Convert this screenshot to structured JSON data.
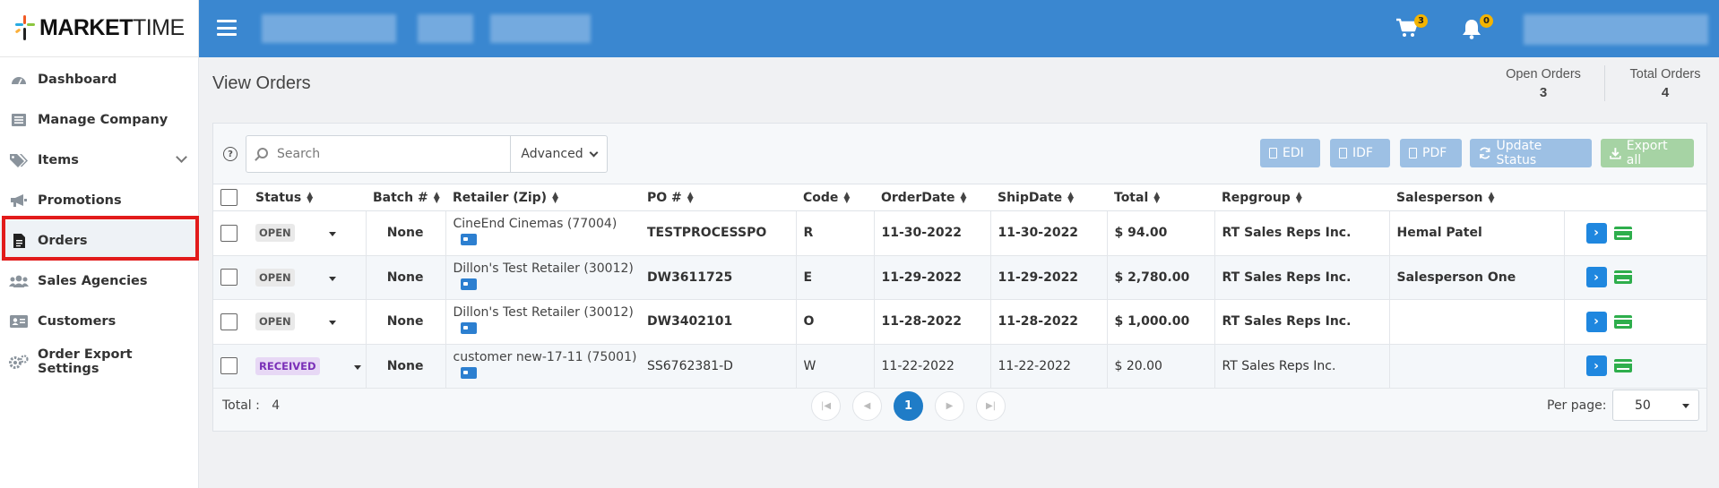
{
  "app": {
    "logo_bold": "MARKET",
    "logo_light": "TIME"
  },
  "sidebar": {
    "items": [
      {
        "label": "Dashboard",
        "icon": "dashboard-icon"
      },
      {
        "label": "Manage Company",
        "icon": "company-list-icon"
      },
      {
        "label": "Items",
        "icon": "tags-icon",
        "expandable": true
      },
      {
        "label": "Promotions",
        "icon": "megaphone-icon"
      },
      {
        "label": "Orders",
        "icon": "document-icon",
        "active": true
      },
      {
        "label": "Sales Agencies",
        "icon": "users-icon"
      },
      {
        "label": "Customers",
        "icon": "id-card-icon"
      },
      {
        "label": "Order Export Settings",
        "icon": "gears-icon"
      }
    ]
  },
  "topbar": {
    "cart_count": "3",
    "notification_count": "0"
  },
  "page": {
    "title": "View Orders",
    "open_orders_label": "Open Orders",
    "open_orders_value": "3",
    "total_orders_label": "Total Orders",
    "total_orders_value": "4"
  },
  "toolbar": {
    "help_glyph": "?",
    "search_placeholder": "Search",
    "advanced_label": "Advanced",
    "edi_label": "EDI",
    "idf_label": "IDF",
    "pdf_label": "PDF",
    "update_status_label": "Update Status",
    "export_all_label": "Export all"
  },
  "table": {
    "headers": [
      "Status",
      "Batch #",
      "Retailer (Zip)",
      "PO #",
      "Code",
      "OrderDate",
      "ShipDate",
      "Total",
      "Repgroup",
      "Salesperson"
    ],
    "rows": [
      {
        "status": "OPEN",
        "batch": "None",
        "retailer": "CineEnd Cinemas (77004)",
        "po": "TESTPROCESSPO",
        "code": "R",
        "order_date": "11-30-2022",
        "ship_date": "11-30-2022",
        "total": "$ 94.00",
        "repgroup": "RT Sales Reps Inc.",
        "salesperson": "Hemal Patel",
        "bold": true
      },
      {
        "status": "OPEN",
        "batch": "None",
        "retailer": "Dillon's Test Retailer (30012)",
        "po": "DW3611725",
        "code": "E",
        "order_date": "11-29-2022",
        "ship_date": "11-29-2022",
        "total": "$ 2,780.00",
        "repgroup": "RT Sales Reps Inc.",
        "salesperson": "Salesperson One",
        "bold": true
      },
      {
        "status": "OPEN",
        "batch": "None",
        "retailer": "Dillon's Test Retailer (30012)",
        "po": "DW3402101",
        "code": "O",
        "order_date": "11-28-2022",
        "ship_date": "11-28-2022",
        "total": "$ 1,000.00",
        "repgroup": "RT Sales Reps Inc.",
        "salesperson": "",
        "bold": true
      },
      {
        "status": "RECEIVED",
        "batch": "None",
        "retailer": "customer new-17-11 (75001)",
        "po": "SS6762381-D",
        "code": "W",
        "order_date": "11-22-2022",
        "ship_date": "11-22-2022",
        "total": "$ 20.00",
        "repgroup": "RT Sales Reps Inc.",
        "salesperson": "",
        "bold": false
      }
    ]
  },
  "footer": {
    "total_label": "Total :",
    "total_value": "4",
    "current_page": "1",
    "per_page_label": "Per page:",
    "per_page_value": "50"
  },
  "colors": {
    "topbar": "#3a87d0",
    "primary": "#1f87df",
    "success": "#2eae4c",
    "highlight": "#e21b1b"
  }
}
